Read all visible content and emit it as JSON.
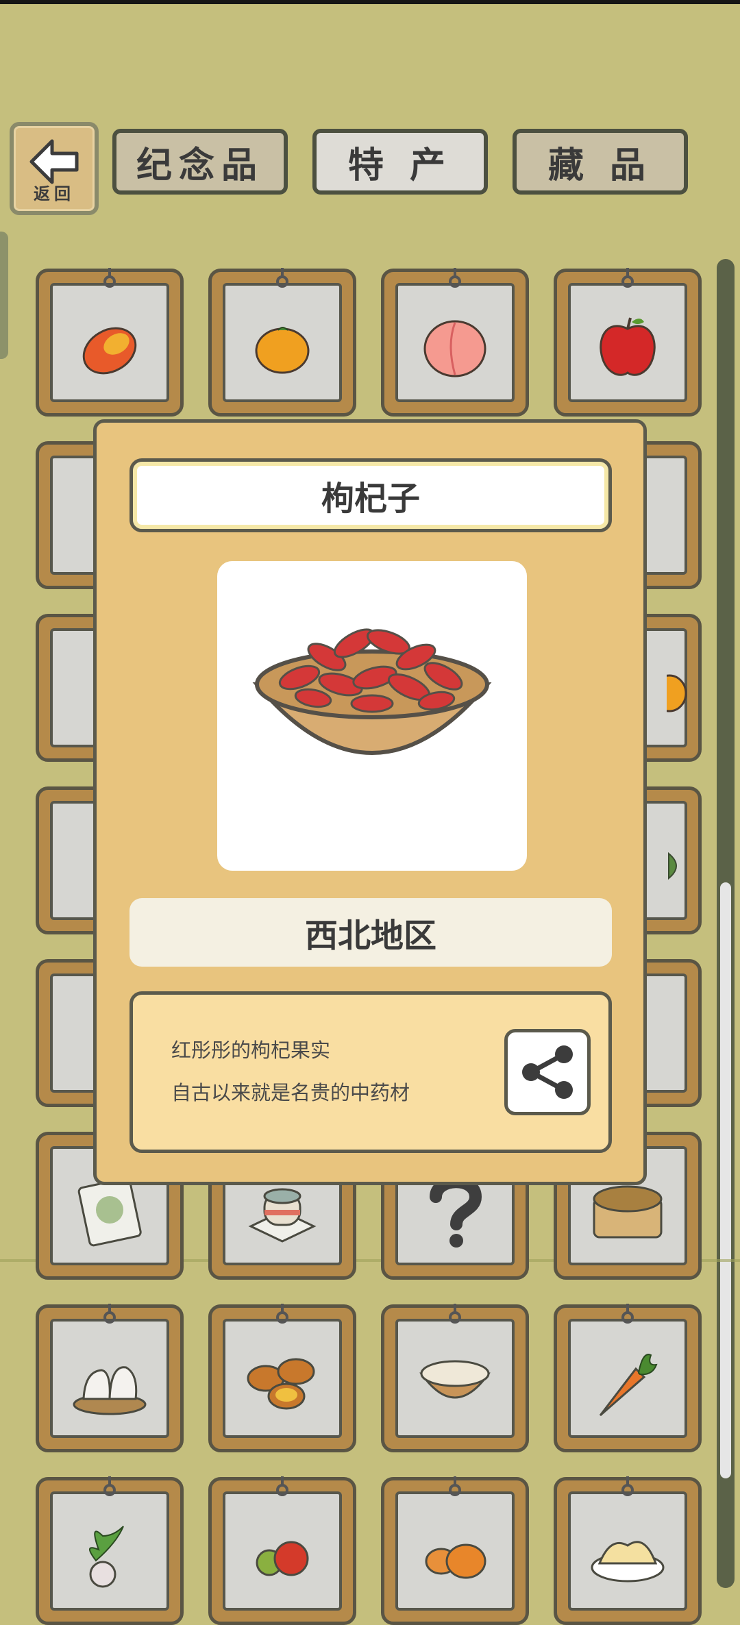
{
  "header": {
    "back_label": "返回",
    "tabs": [
      {
        "label": "纪念品",
        "active": false
      },
      {
        "label": "特 产",
        "active": true
      },
      {
        "label": "藏 品",
        "active": false
      }
    ]
  },
  "grid": {
    "items": [
      {
        "icon": "mango-icon"
      },
      {
        "icon": "orange-icon"
      },
      {
        "icon": "peach-icon"
      },
      {
        "icon": "apple-icon"
      },
      {
        "icon": "unknown-item-icon"
      },
      {
        "icon": "unknown-item-icon"
      },
      {
        "icon": "unknown-item-icon"
      },
      {
        "icon": "unknown-item-icon"
      },
      {
        "icon": "unknown-item-icon"
      },
      {
        "icon": "unknown-item-icon"
      },
      {
        "icon": "unknown-item-icon"
      },
      {
        "icon": "orange-icon"
      },
      {
        "icon": "unknown-item-icon"
      },
      {
        "icon": "unknown-item-icon"
      },
      {
        "icon": "unknown-item-icon"
      },
      {
        "icon": "leaf-icon"
      },
      {
        "icon": "unknown-item-icon"
      },
      {
        "icon": "unknown-item-icon"
      },
      {
        "icon": "unknown-item-icon"
      },
      {
        "icon": "unknown-item-icon"
      },
      {
        "icon": "snack-bag-icon"
      },
      {
        "icon": "cake-icon"
      },
      {
        "icon": "question-mark-icon"
      },
      {
        "icon": "bun-basket-icon"
      },
      {
        "icon": "dumplings-icon"
      },
      {
        "icon": "egg-tarts-icon"
      },
      {
        "icon": "porridge-bowl-icon"
      },
      {
        "icon": "carrot-icon"
      },
      {
        "icon": "radish-icon"
      },
      {
        "icon": "tomatoes-icon"
      },
      {
        "icon": "pumpkins-icon"
      },
      {
        "icon": "noodles-icon"
      }
    ]
  },
  "popup": {
    "name": "枸杞子",
    "image_icon": "goji-berries-bowl-icon",
    "region": "西北地区",
    "description": [
      "红彤彤的枸杞果实",
      "自古以来就是名贵的中药材"
    ],
    "share_icon": "share-icon"
  },
  "colors": {
    "background": "#c5bf7d",
    "card_frame": "#b58a4a",
    "popup_bg": "#e8c47e",
    "desc_bg": "#f9dea2"
  }
}
